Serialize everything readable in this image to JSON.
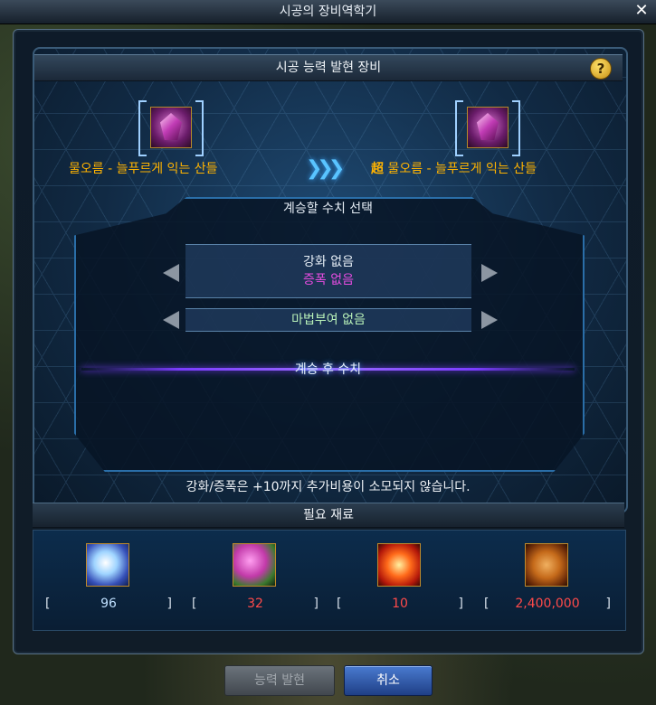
{
  "window": {
    "title": "시공의 장비역학기"
  },
  "header": {
    "title": "시공 능력 발현 장비"
  },
  "items": {
    "source_name": "물오름 - 늘푸르게 익는 산들",
    "target_prefix": "超",
    "target_name": "물오름 - 늘푸르게 익는 산들"
  },
  "selection": {
    "title": "계승할 수치 선택",
    "reinforce_line1": "강화 없음",
    "reinforce_line2": "증폭 없음",
    "enchant": "마법부여 없음",
    "after_label": "계승 후 수치"
  },
  "notice": "강화/증폭은 +10까지 추가비용이 소모되지 않습니다.",
  "materials": {
    "header": "필요 재료",
    "list": [
      {
        "icon": "crystal-icon",
        "count": "96",
        "color": "#bfe0ff"
      },
      {
        "icon": "orb-icon",
        "count": "32",
        "color": "#ff4a4a"
      },
      {
        "icon": "sun-core-icon",
        "count": "10",
        "color": "#ff4a4a"
      },
      {
        "icon": "gold-coins-icon",
        "count": "2,400,000",
        "color": "#ff4a4a"
      }
    ]
  },
  "buttons": {
    "awaken": "능력 발현",
    "cancel": "취소"
  }
}
